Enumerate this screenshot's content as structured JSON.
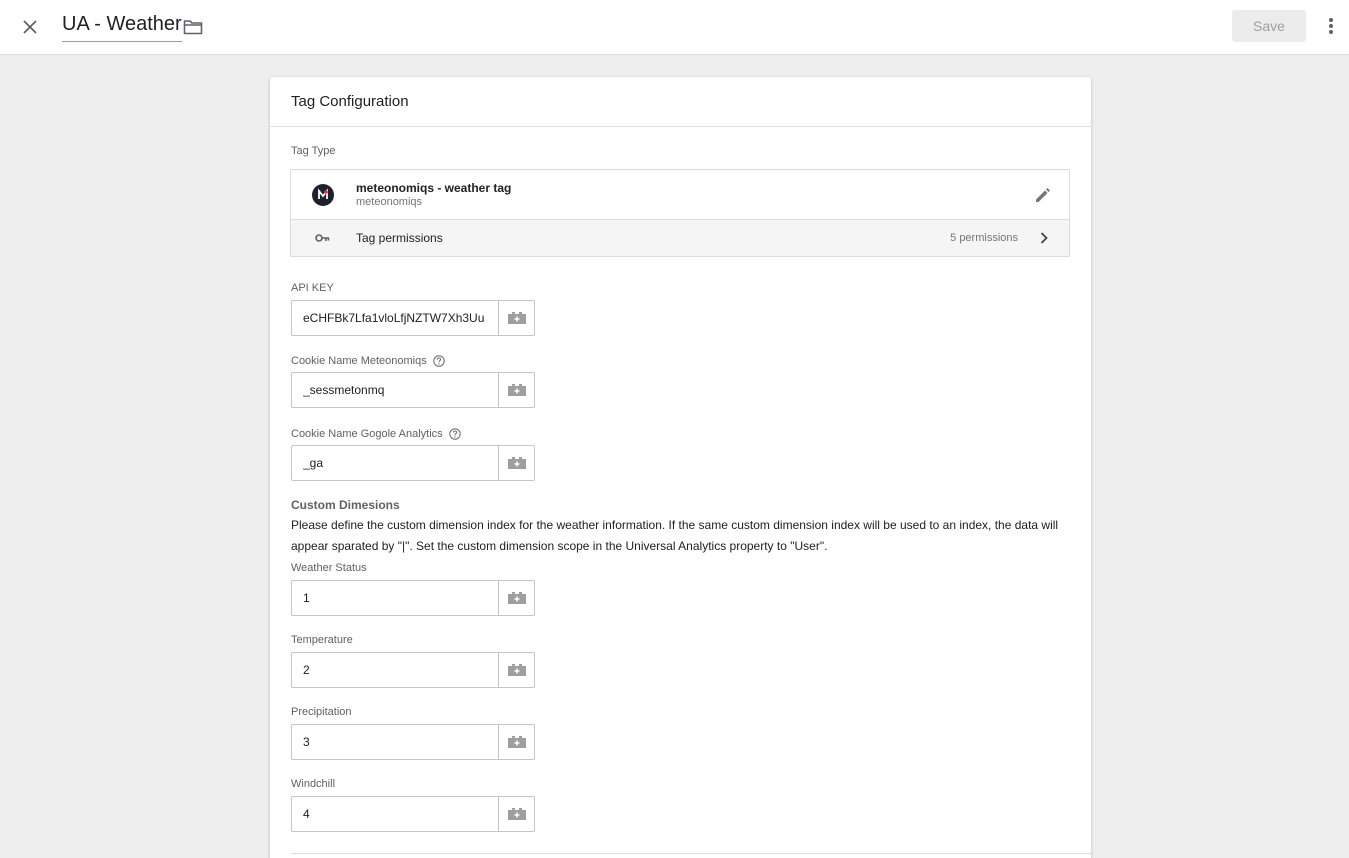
{
  "topbar": {
    "title": "UA - Weather",
    "save_label": "Save",
    "icons": {
      "close": "close-icon",
      "folder": "folder-icon",
      "more": "more-vert-icon"
    }
  },
  "card": {
    "title": "Tag Configuration",
    "tag_type_label": "Tag Type",
    "tag_type": {
      "name": "meteonomiqs - weather tag",
      "vendor": "meteonomiqs",
      "permissions_label": "Tag permissions",
      "permissions_count": "5 permissions"
    },
    "fields": [
      {
        "label": "API KEY",
        "value": "eCHFBk7Lfa1vloLfjNZTW7Xh3Uu",
        "help": false
      },
      {
        "label": "Cookie Name Meteonomiqs",
        "value": "_sessmetonmq",
        "help": true
      },
      {
        "label": "Cookie Name Gogole Analytics",
        "value": "_ga",
        "help": true
      }
    ],
    "custom": {
      "heading": "Custom Dimesions",
      "description": "Please define the custom dimension index for the weather information. If the same custom dimension index will be used to an index, the data will appear sparated by \"|\". Set the custom dimension scope in the Universal Analytics property to \"User\".",
      "fields": [
        {
          "label": "Weather Status",
          "value": "1"
        },
        {
          "label": "Temperature",
          "value": "2"
        },
        {
          "label": "Precipitation",
          "value": "3"
        },
        {
          "label": "Windchill",
          "value": "4"
        }
      ]
    }
  },
  "colors": {
    "background": "#eeeeee",
    "card": "#ffffff",
    "save_disabled_bg": "#ececec",
    "save_disabled_text": "#9e9e9e"
  }
}
